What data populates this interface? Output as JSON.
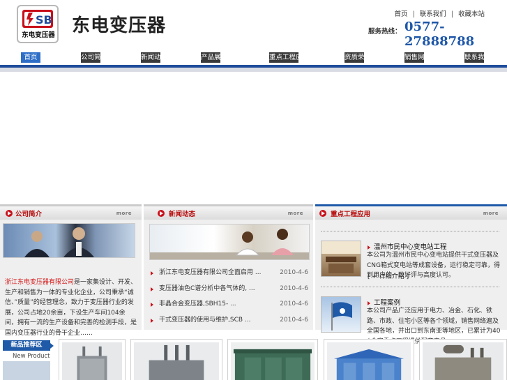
{
  "header": {
    "logo_letters": "SB",
    "logo_text": "东电变压器",
    "brand_title": "东电变压器",
    "top_links": [
      "首页",
      "联系我们",
      "收藏本站"
    ],
    "hotline_label": "服务热线：",
    "hotline_number": "0577-27888788"
  },
  "nav": {
    "items": [
      "首页",
      "公司简介",
      "新闻动态",
      "产品展示",
      "重点工程应用",
      "资质荣誉",
      "销售网络",
      "联系我们"
    ],
    "active_index": 0
  },
  "company": {
    "title": "公司简介",
    "more": "more",
    "intro_highlight": "浙江东电变压器有限公司",
    "intro_text": "是一家集设计、开发、生产和销售为一体的专业化企业，公司秉承“诚信、”质量”的经营理念，致力于变压器行业的发展，公司占地20余亩，下设生产车间104余间，拥有一流的生产设备和完善的检测手段，是国内变压器行业的骨干企业……"
  },
  "news": {
    "title": "新闻动态",
    "more": "more",
    "items": [
      {
        "title": "浙江东电变压器有限公司全面启用 ...",
        "date": "2010-4-6"
      },
      {
        "title": "变压器油色C谱分析中各气体的, ...",
        "date": "2010-4-6"
      },
      {
        "title": "非晶合金变压器,SBH15- ...",
        "date": "2010-4-6"
      },
      {
        "title": "干式变压器的使用与维护,SCB ...",
        "date": "2010-4-6"
      }
    ]
  },
  "projects": {
    "title": "重点工程应用",
    "more": "more",
    "items": [
      {
        "title": "温州市民中心变电站工程",
        "desc": "本公司为温州市民中心变电站提供干式变压器及CNG箱式变电站等成套设备，运行稳定可靠，得到用户的一致好评与高度认可。",
        "more": "[ + 详细介绍 ]"
      },
      {
        "title": "工程案例",
        "desc": "本公司产品广泛应用于电力、冶金、石化、铁路、市政、住宅小区等各个领域，销售网络遍及全国各地，并出口到东南亚等地区，已累计为400余家重点工程提供配套产品。"
      }
    ]
  },
  "products": {
    "head": "新品推荐区",
    "head_en": "New Product",
    "items": [
      {
        "icon": "oil-transformer-icon"
      },
      {
        "icon": "power-transformer-icon"
      },
      {
        "icon": "box-substation-icon"
      },
      {
        "icon": "prefab-substation-icon"
      },
      {
        "icon": "large-transformer-icon"
      }
    ]
  },
  "colors": {
    "brand_blue": "#1e4c9a",
    "accent_red": "#c8101a",
    "hotline_blue": "#1d56a8"
  }
}
